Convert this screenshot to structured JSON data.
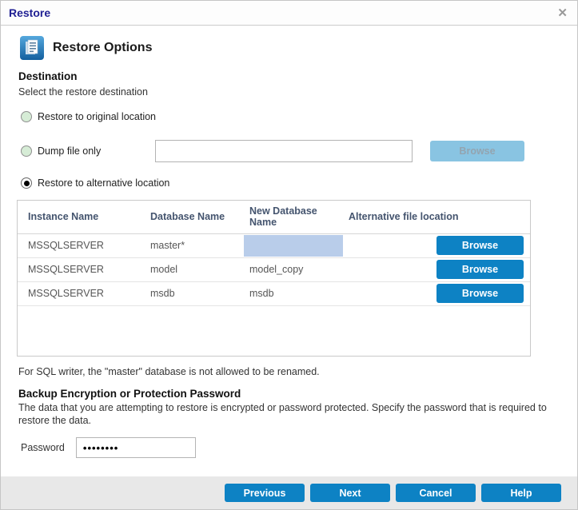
{
  "dialog": {
    "title": "Restore",
    "close_icon": "✕"
  },
  "header": {
    "title": "Restore Options",
    "icon": "document-icon"
  },
  "destination": {
    "heading": "Destination",
    "subheading": "Select the restore destination",
    "options": [
      {
        "label": "Restore to original location",
        "selected": false
      },
      {
        "label": "Dump file only",
        "selected": false
      },
      {
        "label": "Restore to alternative location",
        "selected": true
      }
    ],
    "dump_file_value": "",
    "browse_disabled_label": "Browse"
  },
  "table": {
    "columns": [
      "Instance Name",
      "Database Name",
      "New Database Name",
      "Alternative file location"
    ],
    "rows": [
      {
        "instance": "MSSQLSERVER",
        "database": "master*",
        "new_name": "",
        "location": "",
        "browse_label": "Browse"
      },
      {
        "instance": "MSSQLSERVER",
        "database": "model",
        "new_name": "model_copy",
        "location": "",
        "browse_label": "Browse"
      },
      {
        "instance": "MSSQLSERVER",
        "database": "msdb",
        "new_name": "msdb",
        "location": "",
        "browse_label": "Browse"
      }
    ],
    "note": "For SQL writer, the \"master\" database is not allowed to be renamed."
  },
  "password_section": {
    "heading": "Backup Encryption or Protection Password",
    "description": "The data that you are attempting to restore is encrypted or password protected. Specify the password that is required to restore the data.",
    "label": "Password",
    "value": "••••••••"
  },
  "footer": {
    "buttons": [
      "Previous",
      "Next",
      "Cancel",
      "Help"
    ]
  },
  "colors": {
    "accent_blue": "#0d82c4",
    "disabled_blue": "#89c4e2",
    "title_navy": "#1f1f93",
    "highlight_cell": "#b9cdea",
    "radio_green": "#d6ecd6"
  }
}
